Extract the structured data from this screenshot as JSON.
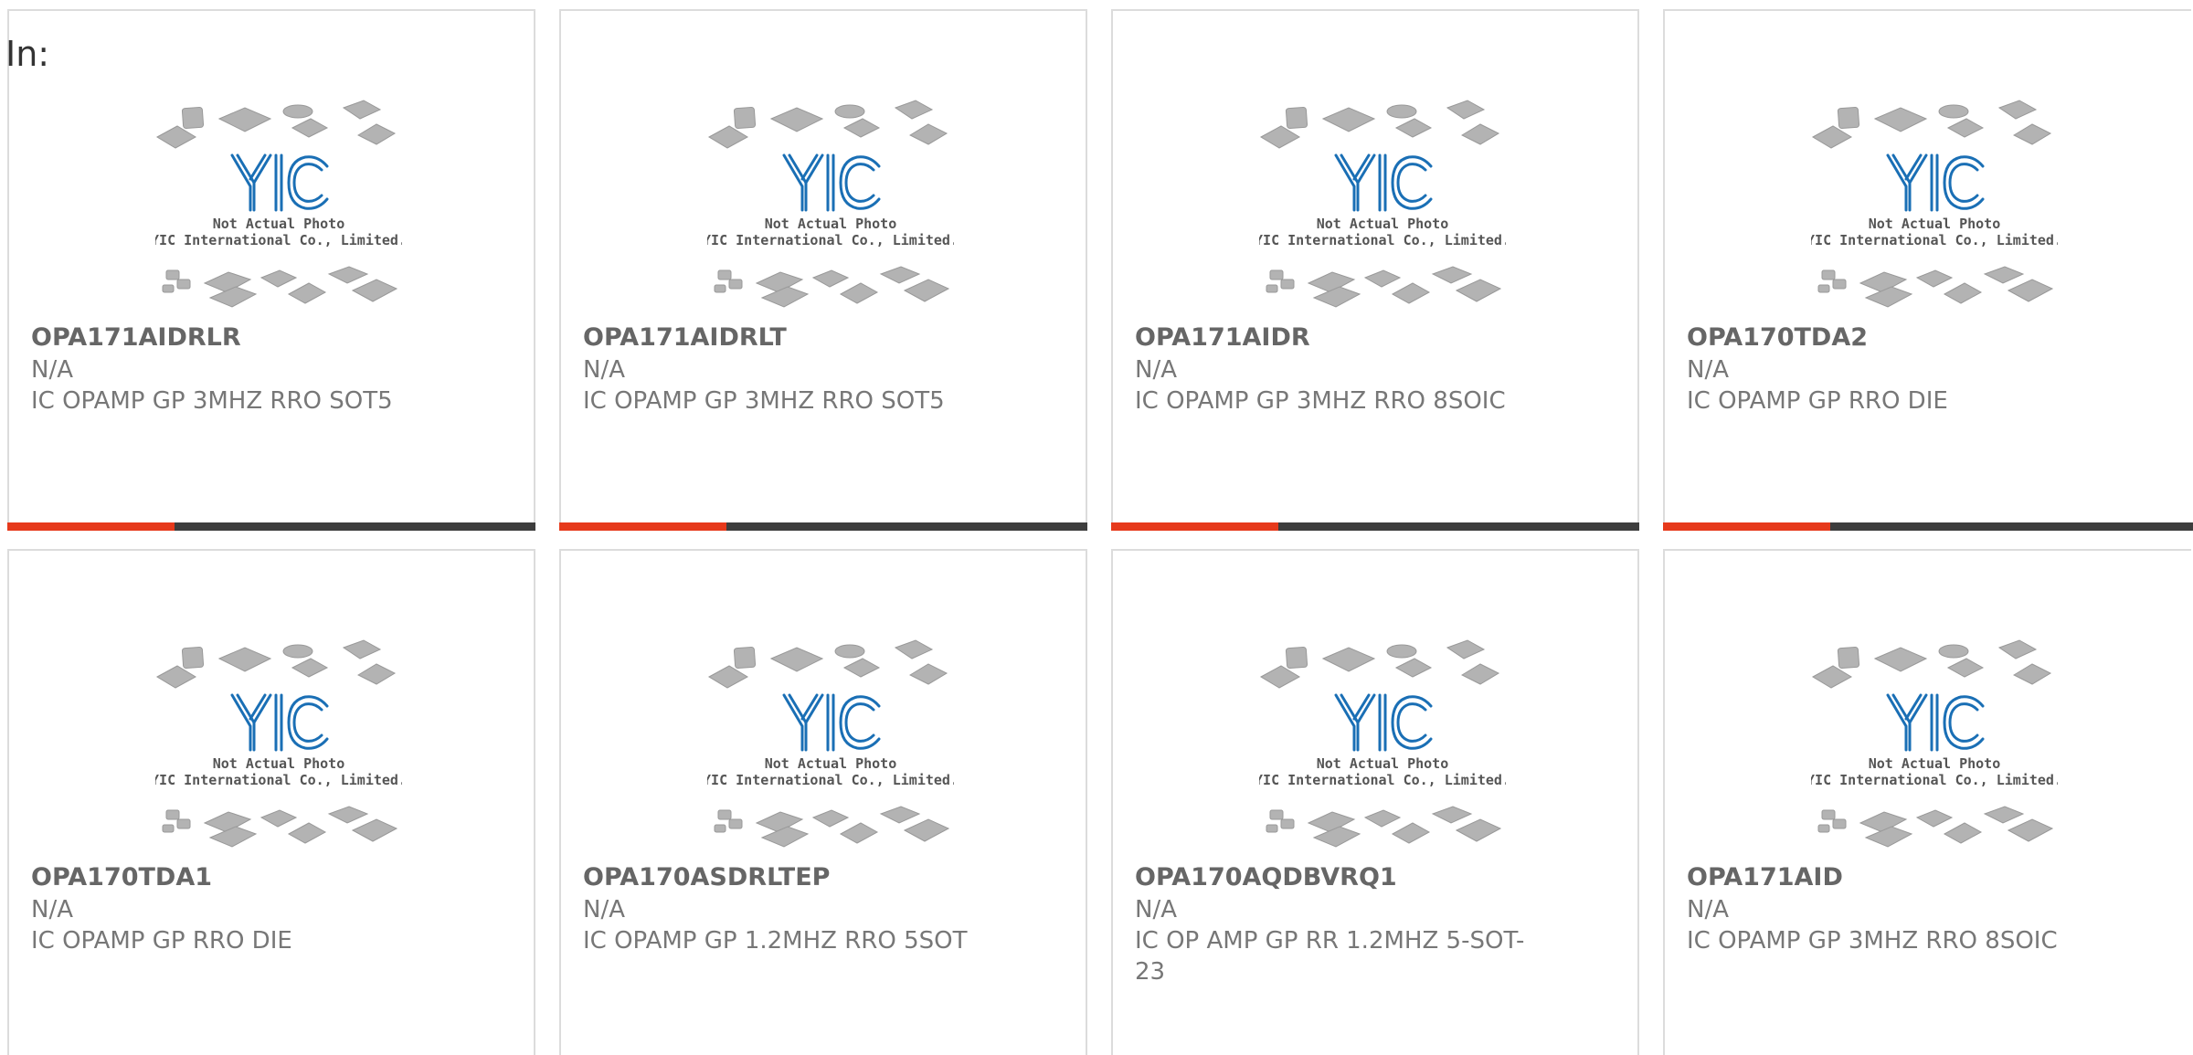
{
  "filter_label": "In:",
  "placeholder": {
    "brand": "YIC",
    "line1": "Not Actual Photo",
    "line2": "YIC International Co., Limited."
  },
  "colors": {
    "accent": "#e6391b",
    "bar_dark": "#3d3d3d",
    "logo_blue": "#1a6fb5",
    "chip_gray": "#b3b3b3"
  },
  "products": [
    {
      "part": "OPA171AIDRLR",
      "manufacturer": "N/A",
      "description": "IC OPAMP GP 3MHZ RRO SOT5"
    },
    {
      "part": "OPA171AIDRLT",
      "manufacturer": "N/A",
      "description": "IC OPAMP GP 3MHZ RRO SOT5"
    },
    {
      "part": "OPA171AIDR",
      "manufacturer": "N/A",
      "description": "IC OPAMP GP 3MHZ RRO 8SOIC"
    },
    {
      "part": "OPA170TDA2",
      "manufacturer": "N/A",
      "description": "IC OPAMP GP RRO DIE"
    },
    {
      "part": "OPA170TDA1",
      "manufacturer": "N/A",
      "description": "IC OPAMP GP RRO DIE"
    },
    {
      "part": "OPA170ASDRLTEP",
      "manufacturer": "N/A",
      "description": "IC OPAMP GP 1.2MHZ RRO 5SOT"
    },
    {
      "part": "OPA170AQDBVRQ1",
      "manufacturer": "N/A",
      "description": "IC OP AMP GP RR 1.2MHZ 5-SOT-23"
    },
    {
      "part": "OPA171AID",
      "manufacturer": "N/A",
      "description": "IC OPAMP GP 3MHZ RRO 8SOIC"
    }
  ]
}
